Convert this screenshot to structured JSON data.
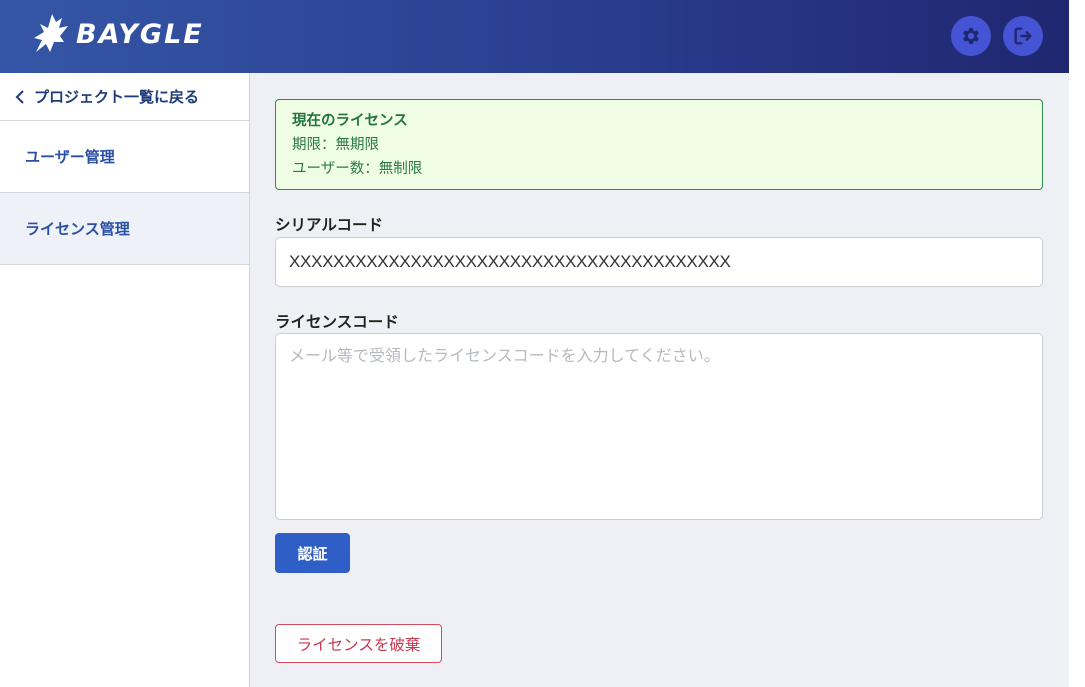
{
  "header": {
    "brand": "BAYGLE",
    "settings_icon": "gear-icon",
    "logout_icon": "logout-icon"
  },
  "sidebar": {
    "back_label": "プロジェクト一覧に戻る",
    "items": [
      {
        "label": "ユーザー管理",
        "active": false
      },
      {
        "label": "ライセンス管理",
        "active": true
      }
    ]
  },
  "license": {
    "title": "現在のライセンス",
    "expiry": "期限：無期限",
    "users": "ユーザー数：無制限"
  },
  "serial": {
    "label": "シリアルコード",
    "value": "XXXXXXXXXXXXXXXXXXXXXXXXXXXXXXXXXXXXXXXX"
  },
  "license_code": {
    "label": "ライセンスコード",
    "placeholder": "メール等で受領したライセンスコードを入力してください。"
  },
  "buttons": {
    "auth": "認証",
    "discard": "ライセンスを破棄"
  },
  "colors": {
    "header_start": "#3556a6",
    "header_end": "#1f2770",
    "primary": "#2f5fc6",
    "danger": "#c73a4f",
    "success_bg": "#f0fde5",
    "success_text": "#2b7a44"
  }
}
